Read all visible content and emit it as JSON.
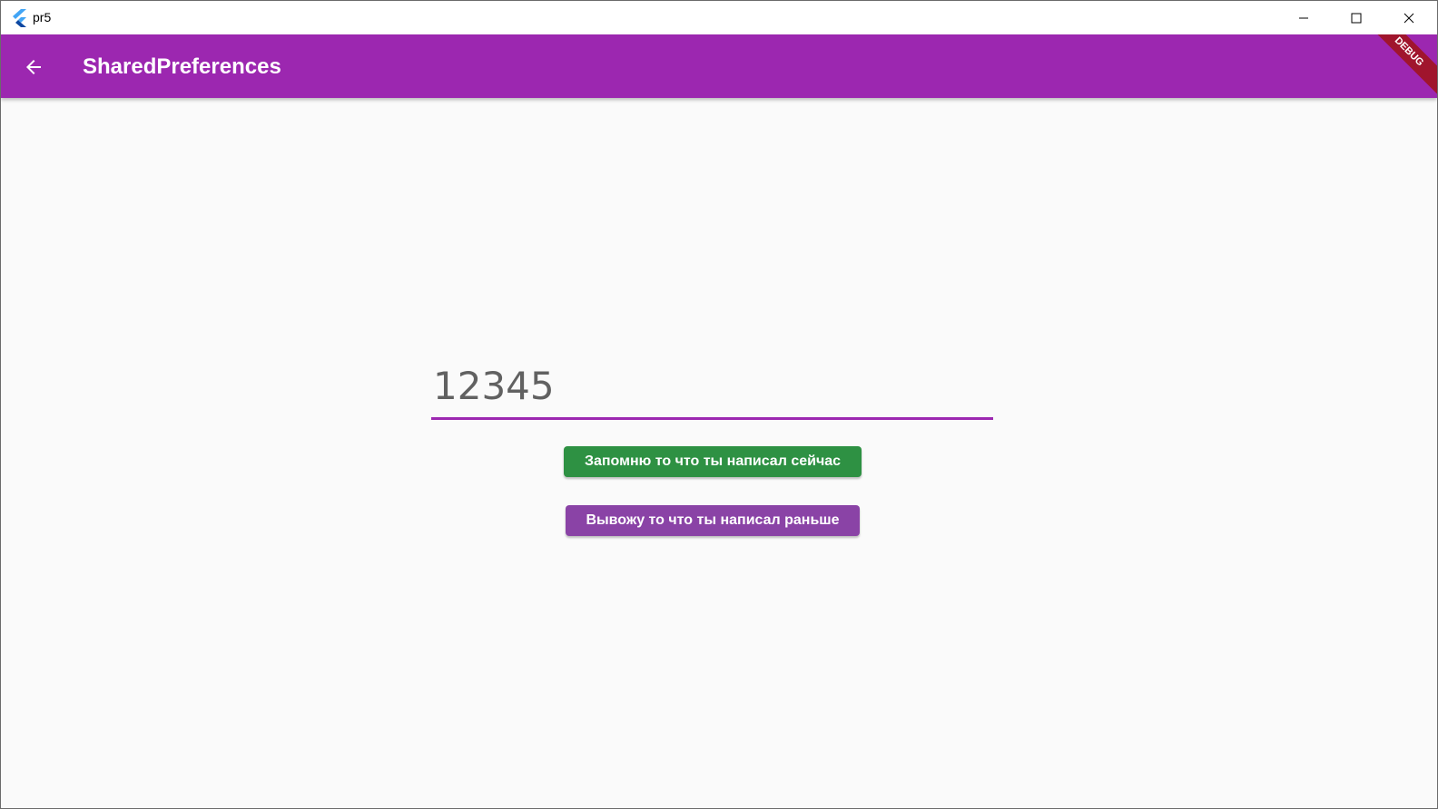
{
  "window": {
    "title": "pr5",
    "icon": "flutter-logo-icon",
    "controls": {
      "minimize_icon": "minimize-icon",
      "maximize_icon": "maximize-icon",
      "close_icon": "close-icon"
    }
  },
  "appbar": {
    "title": "SharedPreferences",
    "back_icon": "arrow-back-icon",
    "debug_banner": "DEBUG",
    "color": "#9c27b0"
  },
  "main": {
    "text_field": {
      "value": "12345",
      "accent_color": "#9c27b0"
    },
    "save_button": {
      "label": "Запомню то что ты написал сейчас",
      "color": "#2e9143"
    },
    "load_button": {
      "label": "Вывожу то что ты написал раньше",
      "color": "#8a43a6"
    }
  }
}
